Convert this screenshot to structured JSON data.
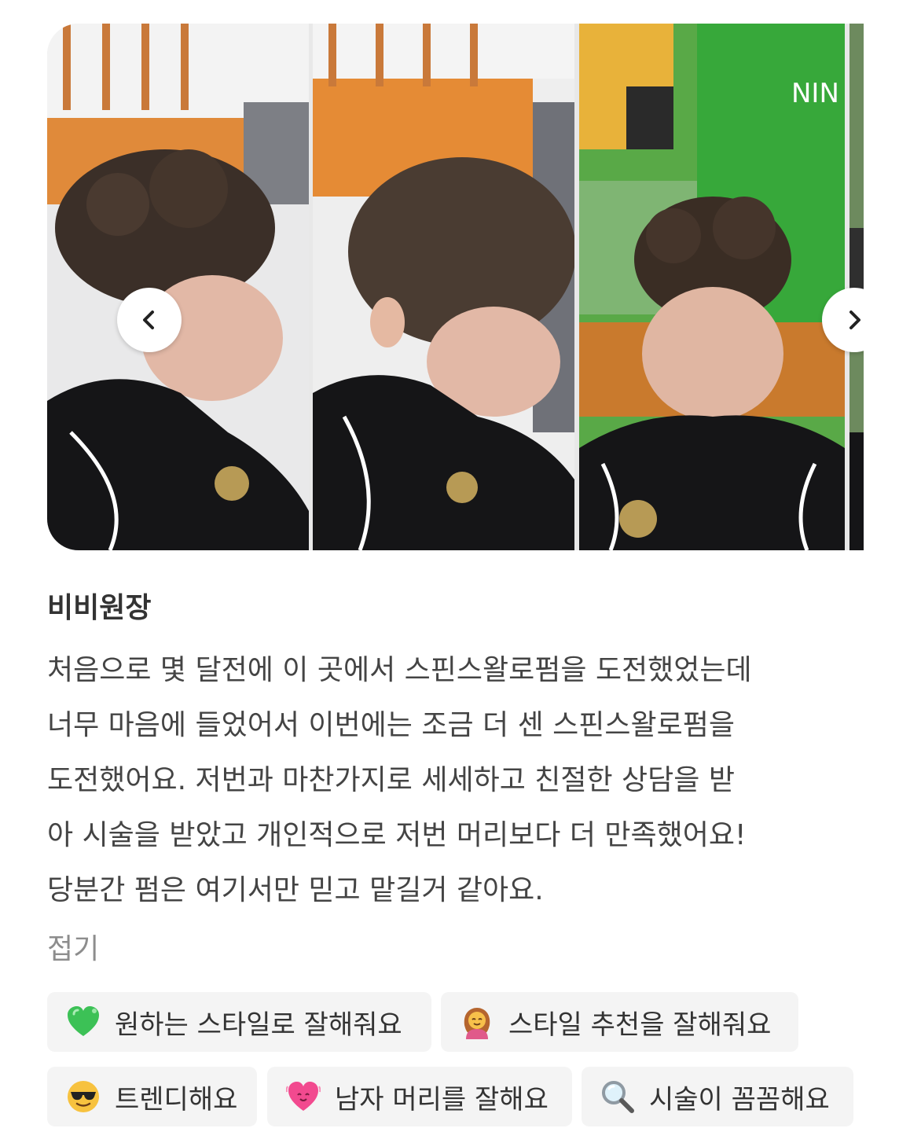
{
  "carousel": {
    "photos": [
      {
        "alt": "side-curly-perm-photo"
      },
      {
        "alt": "side-smooth-hair-photo"
      },
      {
        "alt": "front-curly-perm-photo"
      },
      {
        "alt": "partial-next-photo"
      }
    ],
    "prev_icon": "chevron-left-icon",
    "next_icon": "chevron-right-icon"
  },
  "review": {
    "author": "비비원장",
    "lines": [
      "처음으로 몇 달전에 이 곳에서 스핀스왈로펌을 도전했었는데",
      "너무 마음에 들었어서 이번에는 조금 더 센 스핀스왈로펌을",
      "도전했어요. 저번과 마찬가지로 세세하고 친절한 상담을 받",
      "아 시술을 받았고 개인적으로 저번 머리보다 더 만족했어요!",
      "당분간 펌은 여기서만 믿고 맡길거 같아요."
    ],
    "collapse_label": "접기"
  },
  "tags": [
    {
      "label": "원하는 스타일로 잘해줘요",
      "icon": "green-heart-icon"
    },
    {
      "label": "스타일 추천을 잘해줘요",
      "icon": "woman-emoji-icon"
    },
    {
      "label": "트렌디해요",
      "icon": "sunglasses-face-icon"
    },
    {
      "label": "남자 머리를 잘해요",
      "icon": "pink-heart-icon"
    },
    {
      "label": "시술이 꼼꼼해요",
      "icon": "magnifier-icon"
    }
  ],
  "colors": {
    "tag_bg": "#f4f4f4",
    "text": "#444444",
    "muted": "#8d8d8d"
  }
}
